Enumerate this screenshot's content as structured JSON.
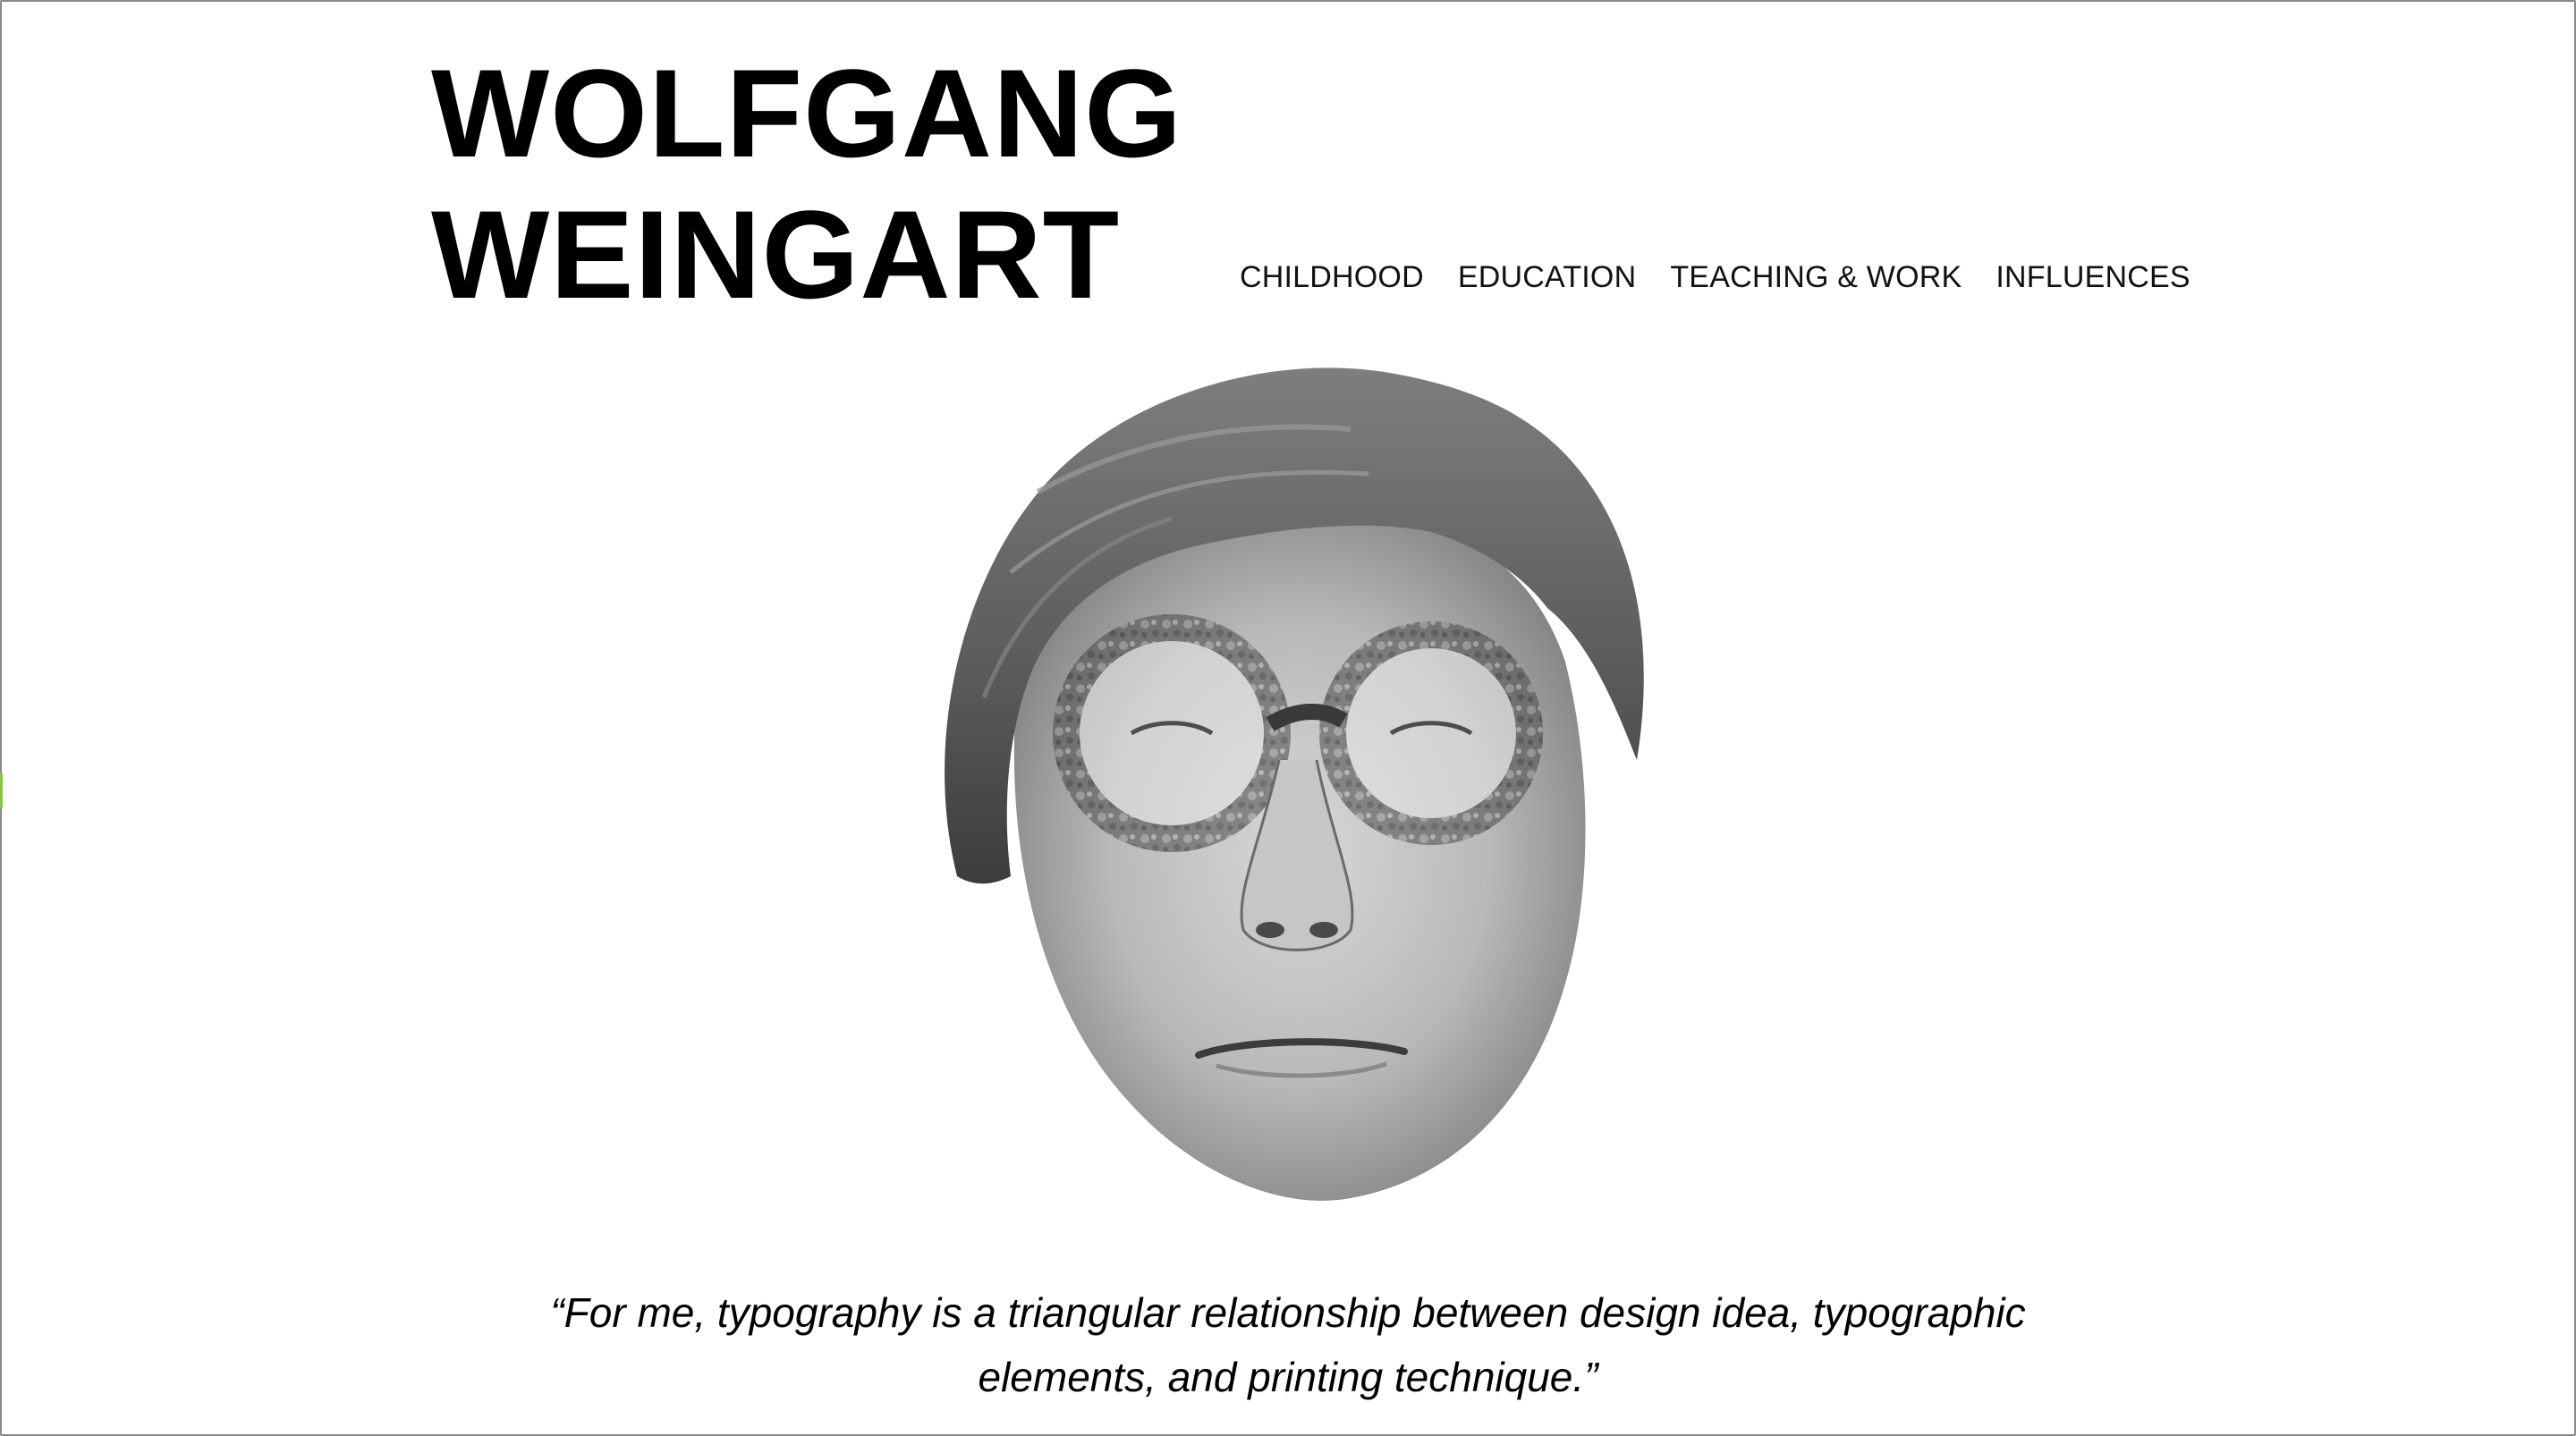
{
  "header": {
    "title_line1": "WOLFGANG",
    "title_line2": "WEINGART"
  },
  "nav": {
    "items": [
      {
        "label": "CHILDHOOD"
      },
      {
        "label": "EDUCATION"
      },
      {
        "label": "TEACHING & WORK"
      },
      {
        "label": "INFLUENCES"
      }
    ]
  },
  "hero": {
    "image_subject": "black-and-white cut-out portrait of Wolfgang Weingart with round tortoiseshell glasses"
  },
  "quote": {
    "line1": "“For me, typography is a triangular relationship between design idea, typographic",
    "line2": "elements, and printing technique.”"
  },
  "colors": {
    "background": "#ffffff",
    "text": "#000000",
    "frame": "#8a8a8a"
  }
}
